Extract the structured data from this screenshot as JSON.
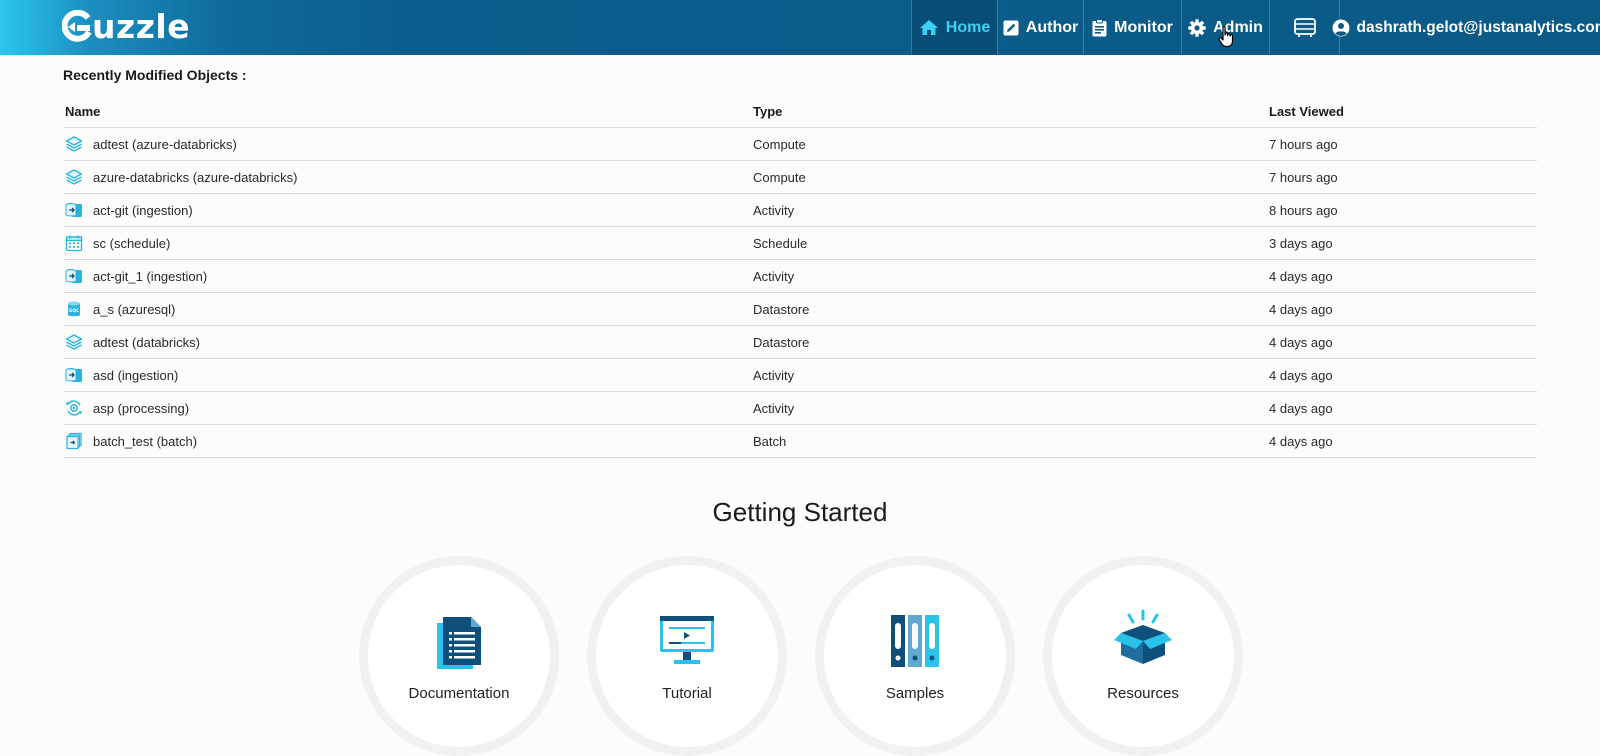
{
  "app": {
    "logo_text": "uzzle"
  },
  "nav": {
    "home": "Home",
    "author": "Author",
    "monitor": "Monitor",
    "admin": "Admin",
    "user": "dashrath.gelot@justanalytics.com"
  },
  "recent": {
    "title": "Recently Modified Objects :",
    "columns": {
      "name": "Name",
      "type": "Type",
      "last_viewed": "Last Viewed"
    },
    "rows": [
      {
        "name": "adtest (azure-databricks)",
        "type": "Compute",
        "last": "7 hours ago",
        "icon": "layers-icon"
      },
      {
        "name": "azure-databricks (azure-databricks)",
        "type": "Compute",
        "last": "7 hours ago",
        "icon": "layers-icon"
      },
      {
        "name": "act-git (ingestion)",
        "type": "Activity",
        "last": "8 hours ago",
        "icon": "ingestion-icon"
      },
      {
        "name": "sc (schedule)",
        "type": "Schedule",
        "last": "3 days ago",
        "icon": "calendar-icon"
      },
      {
        "name": "act-git_1 (ingestion)",
        "type": "Activity",
        "last": "4 days ago",
        "icon": "ingestion-icon"
      },
      {
        "name": "a_s (azuresql)",
        "type": "Datastore",
        "last": "4 days ago",
        "icon": "sql-database-icon"
      },
      {
        "name": "adtest (databricks)",
        "type": "Datastore",
        "last": "4 days ago",
        "icon": "layers-icon"
      },
      {
        "name": "asd (ingestion)",
        "type": "Activity",
        "last": "4 days ago",
        "icon": "ingestion-icon"
      },
      {
        "name": "asp (processing)",
        "type": "Activity",
        "last": "4 days ago",
        "icon": "processing-icon"
      },
      {
        "name": "batch_test (batch)",
        "type": "Batch",
        "last": "4 days ago",
        "icon": "batch-icon"
      }
    ]
  },
  "getting_started": {
    "title": "Getting Started",
    "cards": {
      "documentation": "Documentation",
      "tutorial": "Tutorial",
      "samples": "Samples",
      "resources": "Resources"
    }
  },
  "colors": {
    "accent": "#2bc6ec",
    "header_dark": "#0b5a86",
    "active_nav": "#084d76",
    "active_text": "#3dd0f4"
  }
}
